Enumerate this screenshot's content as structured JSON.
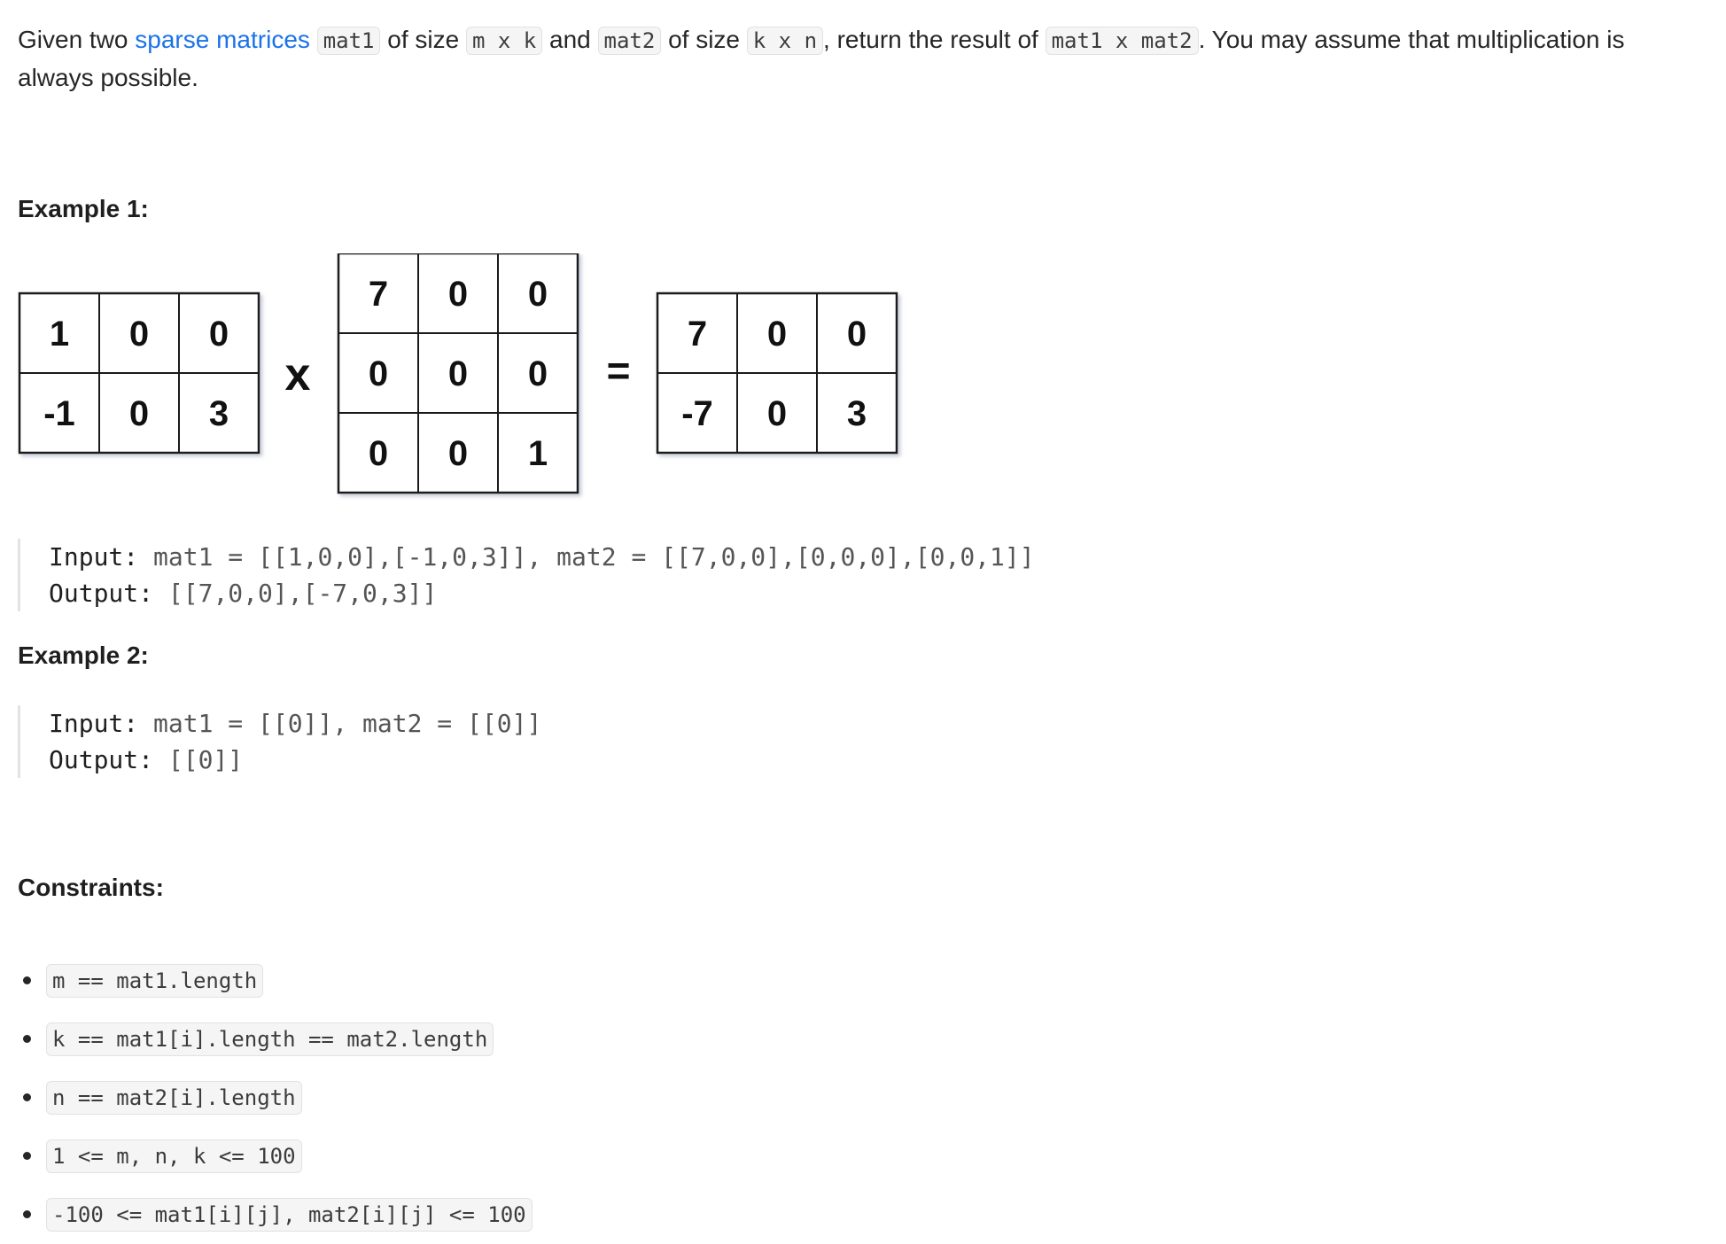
{
  "intro": {
    "t1": "Given two ",
    "link": "sparse matrices",
    "t2": " ",
    "c1": "mat1",
    "t3": " of size ",
    "c2": "m x k",
    "t4": " and ",
    "c3": "mat2",
    "t5": " of size ",
    "c4": "k x n",
    "t6": ", return the result of ",
    "c5": "mat1 x mat2",
    "t7": ". You may assume that multiplication is always possible."
  },
  "example1": {
    "heading": "Example 1:",
    "diagram": {
      "mat1": [
        [
          "1",
          "0",
          "0"
        ],
        [
          "-1",
          "0",
          "3"
        ]
      ],
      "mat2": [
        [
          "7",
          "0",
          "0"
        ],
        [
          "0",
          "0",
          "0"
        ],
        [
          "0",
          "0",
          "1"
        ]
      ],
      "result": [
        [
          "7",
          "0",
          "0"
        ],
        [
          "-7",
          "0",
          "3"
        ]
      ],
      "times_symbol": "x",
      "equals_symbol": "="
    },
    "input_label": "Input:",
    "input_value": " mat1 = [[1,0,0],[-1,0,3]], mat2 = [[7,0,0],[0,0,0],[0,0,1]]",
    "output_label": "Output:",
    "output_value": " [[7,0,0],[-7,0,3]]"
  },
  "example2": {
    "heading": "Example 2:",
    "input_label": "Input:",
    "input_value": " mat1 = [[0]], mat2 = [[0]]",
    "output_label": "Output:",
    "output_value": " [[0]]"
  },
  "constraints": {
    "heading": "Constraints:",
    "items": [
      "m == mat1.length",
      "k == mat1[i].length == mat2.length",
      "n == mat2[i].length",
      "1 <= m, n, k <= 100",
      "-100 <= mat1[i][j], mat2[i][j] <= 100"
    ]
  }
}
